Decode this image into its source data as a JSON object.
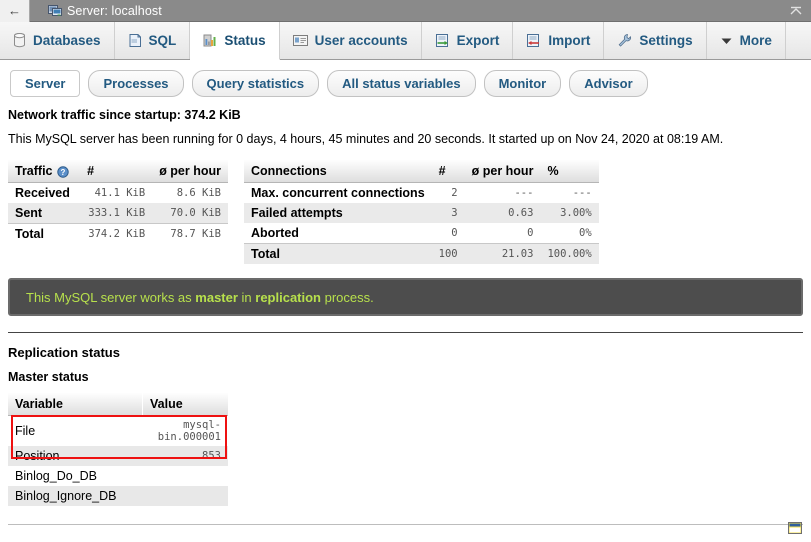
{
  "window": {
    "title": "Server: localhost",
    "back_label": "←",
    "collapse_label": "↥",
    "server_icon": "server-icon"
  },
  "mainnav": {
    "tabs": [
      {
        "label": "Databases",
        "icon": "database-icon",
        "active": false
      },
      {
        "label": "SQL",
        "icon": "sql-document-icon",
        "active": false
      },
      {
        "label": "Status",
        "icon": "bar-chart-icon",
        "active": true
      },
      {
        "label": "User accounts",
        "icon": "id-card-icon",
        "active": false
      },
      {
        "label": "Export",
        "icon": "export-icon",
        "active": false
      },
      {
        "label": "Import",
        "icon": "import-icon",
        "active": false
      },
      {
        "label": "Settings",
        "icon": "wrench-icon",
        "active": false
      },
      {
        "label": "More",
        "icon": "chevron-down-icon",
        "active": false
      }
    ]
  },
  "subnav": {
    "tabs": [
      {
        "label": "Server",
        "active": true
      },
      {
        "label": "Processes",
        "active": false
      },
      {
        "label": "Query statistics",
        "active": false
      },
      {
        "label": "All status variables",
        "active": false
      },
      {
        "label": "Monitor",
        "active": false
      },
      {
        "label": "Advisor",
        "active": false
      }
    ]
  },
  "summary": {
    "network_traffic": "Network traffic since startup: 374.2 KiB",
    "uptime": "This MySQL server has been running for 0 days, 4 hours, 45 minutes and 20 seconds. It started up on Nov 24, 2020 at 08:19 AM."
  },
  "traffic_table": {
    "headers": [
      "Traffic",
      "#",
      "ø per hour"
    ],
    "help_icon": "help-icon",
    "rows": [
      {
        "label": "Received",
        "count": "41.1 KiB",
        "per_hour": "8.6 KiB"
      },
      {
        "label": "Sent",
        "count": "333.1 KiB",
        "per_hour": "70.0 KiB"
      },
      {
        "label": "Total",
        "count": "374.2 KiB",
        "per_hour": "78.7 KiB"
      }
    ]
  },
  "connections_table": {
    "headers": [
      "Connections",
      "#",
      "ø per hour",
      "%"
    ],
    "rows": [
      {
        "label": "Max. concurrent connections",
        "count": "2",
        "per_hour": "---",
        "pct": "---"
      },
      {
        "label": "Failed attempts",
        "count": "3",
        "per_hour": "0.63",
        "pct": "3.00%"
      },
      {
        "label": "Aborted",
        "count": "0",
        "per_hour": "0",
        "pct": "0%"
      },
      {
        "label": "Total",
        "count": "100",
        "per_hour": "21.03",
        "pct": "100.00%"
      }
    ]
  },
  "notice": {
    "prefix": "This MySQL server works as ",
    "bold1": "master",
    "middle": " in ",
    "bold2": "replication",
    "suffix": " process."
  },
  "replication": {
    "section_title": "Replication status",
    "subsection_title": "Master status",
    "headers": [
      "Variable",
      "Value"
    ],
    "rows": [
      {
        "variable": "File",
        "value": "mysql-bin.000001"
      },
      {
        "variable": "Position",
        "value": "853"
      },
      {
        "variable": "Binlog_Do_DB",
        "value": ""
      },
      {
        "variable": "Binlog_Ignore_DB",
        "value": ""
      }
    ],
    "highlight_color": "#ee1111"
  },
  "footer": {
    "console_icon": "console-window-icon"
  },
  "colors": {
    "titlebar_bg": "#8a8a8a",
    "link_blue": "#235a81",
    "notice_bg": "#4d4d4d",
    "notice_text": "#b7e04c",
    "highlight_red": "#ee1111"
  }
}
